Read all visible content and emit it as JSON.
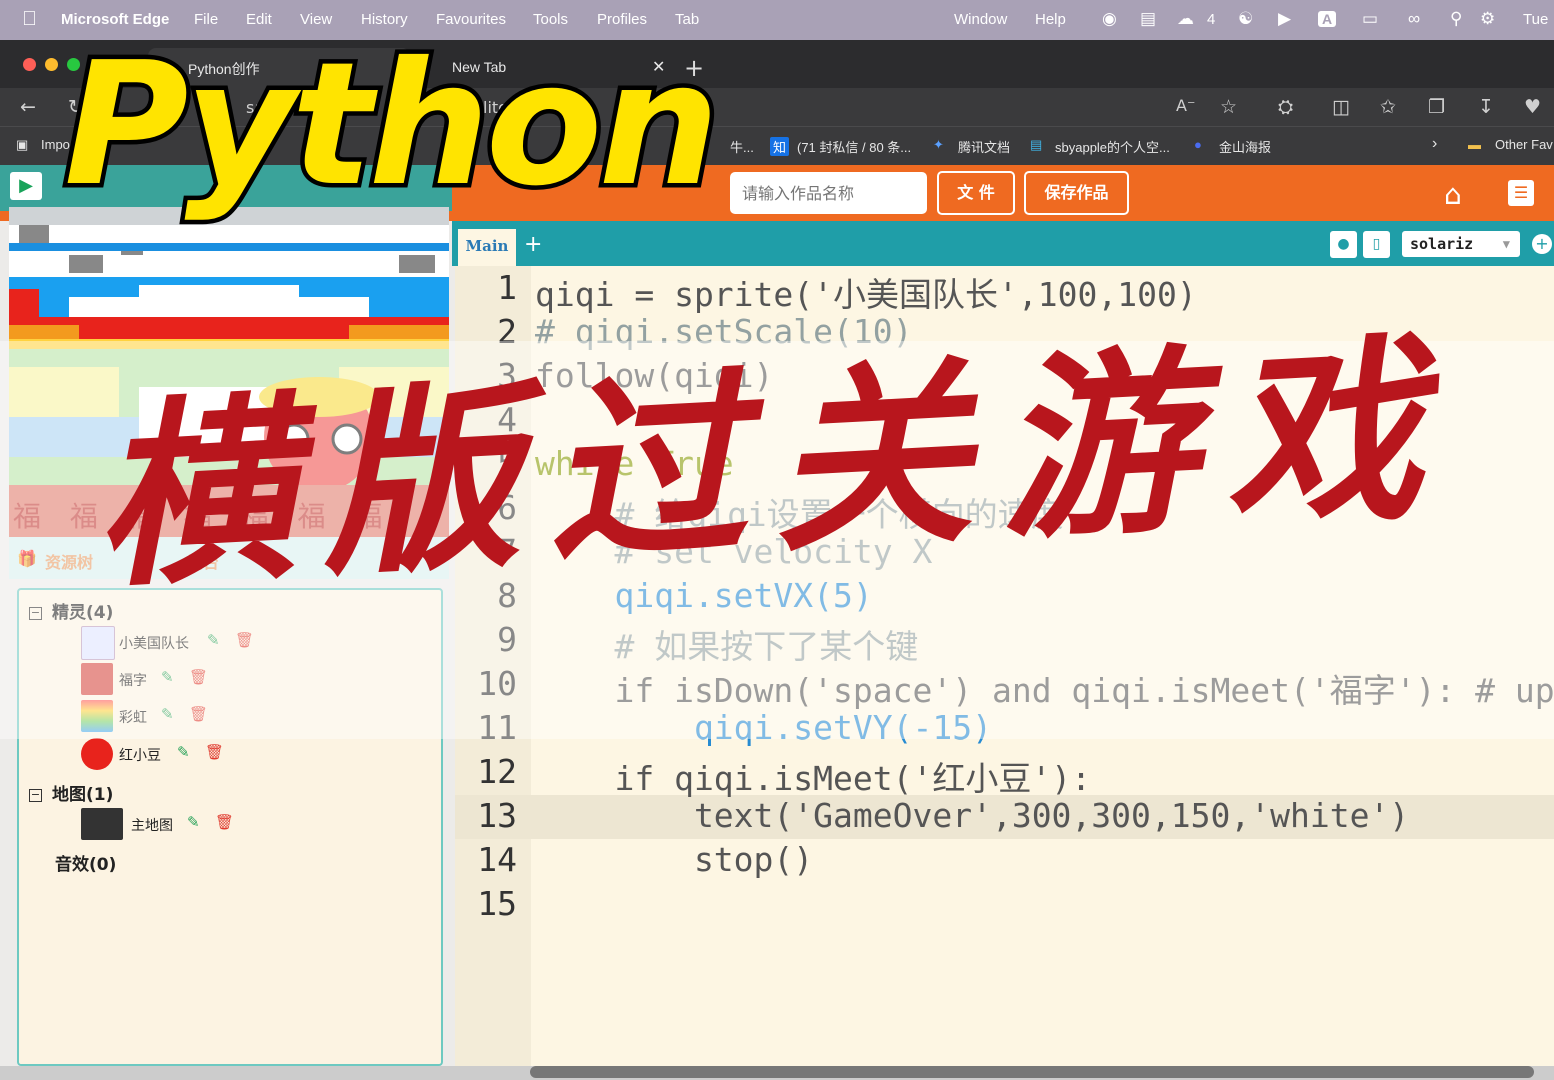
{
  "menubar": {
    "app_name": "Microsoft Edge",
    "items": [
      "File",
      "Edit",
      "View",
      "History",
      "Favourites",
      "Tools",
      "Profiles",
      "Tab",
      "Window",
      "Help"
    ],
    "wechat_count": "4",
    "clock": "Tue"
  },
  "browser": {
    "tabs": [
      "Python创作",
      "New Tab"
    ],
    "address_fragment": "s://v",
    "address_tail": "litor",
    "favorites": [
      "Impo",
      "牛...",
      "(71 封私信 / 80 条...",
      "腾讯文档",
      "sbyapple的个人空...",
      "金山海报",
      "Other Fav"
    ]
  },
  "app": {
    "name_placeholder": "请输入作品名称",
    "file_button": "文 件",
    "save_button": "保存作品",
    "editor_tab": "Main",
    "theme": "solariz"
  },
  "resource_panel": {
    "tab_resources": "资源树",
    "tab_console": "制台",
    "sprites_group": "精灵(4)",
    "sprites": [
      "小美国队长",
      "福字",
      "彩虹",
      "红小豆"
    ],
    "maps_group": "地图(1)",
    "maps": [
      "主地图"
    ],
    "sounds_group": "音效(0)"
  },
  "stage": {
    "banner_text": "福 福 福 福 福 福 福"
  },
  "code": {
    "line_numbers": [
      "1",
      "2",
      "3",
      "4",
      "5",
      "6",
      "7",
      "8",
      "9",
      "10",
      "11",
      "12",
      "13",
      "14",
      "15"
    ],
    "lines": [
      "qiqi = sprite('小美国队长',100,100)",
      "# qiqi.setScale(10)",
      "follow(qiqi)",
      "",
      "while True",
      "    # 给qiqi设置一个横向的速度",
      "    # set velocity X",
      "    qiqi.setVX(5)",
      "    # 如果按下了某个键",
      "    if isDown('space') and qiqi.isMeet('福字'): # up",
      "        qiqi.setVY(-15)",
      "    if qiqi.isMeet('红小豆'):",
      "        text('GameOver',300,300,150,'white')",
      "        stop()",
      ""
    ]
  },
  "overlay": {
    "title_en": "Python",
    "title_cn": "横版过关游戏"
  }
}
